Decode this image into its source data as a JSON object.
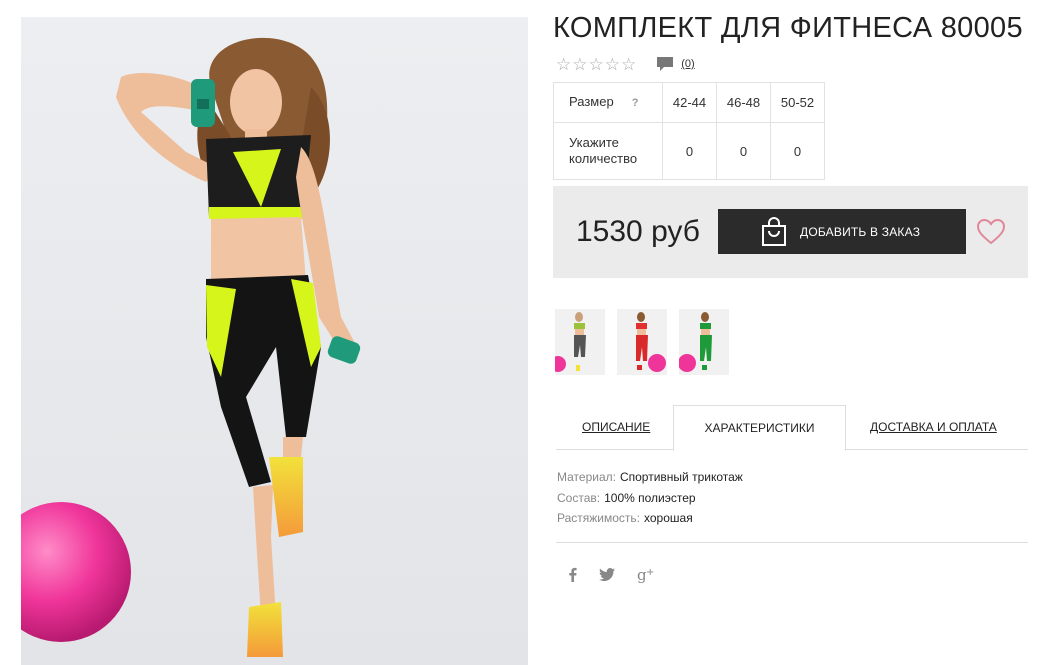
{
  "product": {
    "title": "КОМПЛЕКТ ДЛЯ ФИТНЕСА 80005",
    "rating": {
      "stars": [
        "☆",
        "☆",
        "☆",
        "☆",
        "☆"
      ],
      "review_count": "(0)"
    },
    "size_table": {
      "size_label": "Размер",
      "help_mark": "?",
      "sizes": [
        "42-44",
        "46-48",
        "50-52"
      ],
      "quantity_label": "Укажите количество",
      "quantities": [
        "0",
        "0",
        "0"
      ]
    },
    "price": "1530 руб",
    "add_to_order_label": "ДОБАВИТЬ В ЗАКАЗ"
  },
  "tabs": [
    {
      "label": "ОПИСАНИЕ",
      "active": false
    },
    {
      "label": "ХАРАКТЕРИСТИКИ",
      "active": true
    },
    {
      "label": "ДОСТАВКА И ОПЛАТА",
      "active": false
    }
  ],
  "specs": [
    {
      "key": "Материал:",
      "value": "Спортивный трикотаж"
    },
    {
      "key": "Состав:",
      "value": "100% полиэстер"
    },
    {
      "key": "Растяжимость:",
      "value": "хорошая"
    }
  ],
  "thumbnails": [
    {
      "name": "grey-variant",
      "top_color": "#9bc23a",
      "bottom_color": "#555555"
    },
    {
      "name": "red-variant",
      "top_color": "#e03030",
      "bottom_color": "#d82a2a"
    },
    {
      "name": "green-variant",
      "top_color": "#1f9a3a",
      "bottom_color": "#1f9a3a"
    }
  ],
  "social": [
    "facebook-icon",
    "twitter-icon",
    "google-plus-icon"
  ],
  "colors": {
    "accent_button": "#2b2b2b",
    "heart": "#e0889a",
    "buy_box_bg": "#ebebeb",
    "neon": "#d6f51a",
    "ball": "#f0359a"
  }
}
